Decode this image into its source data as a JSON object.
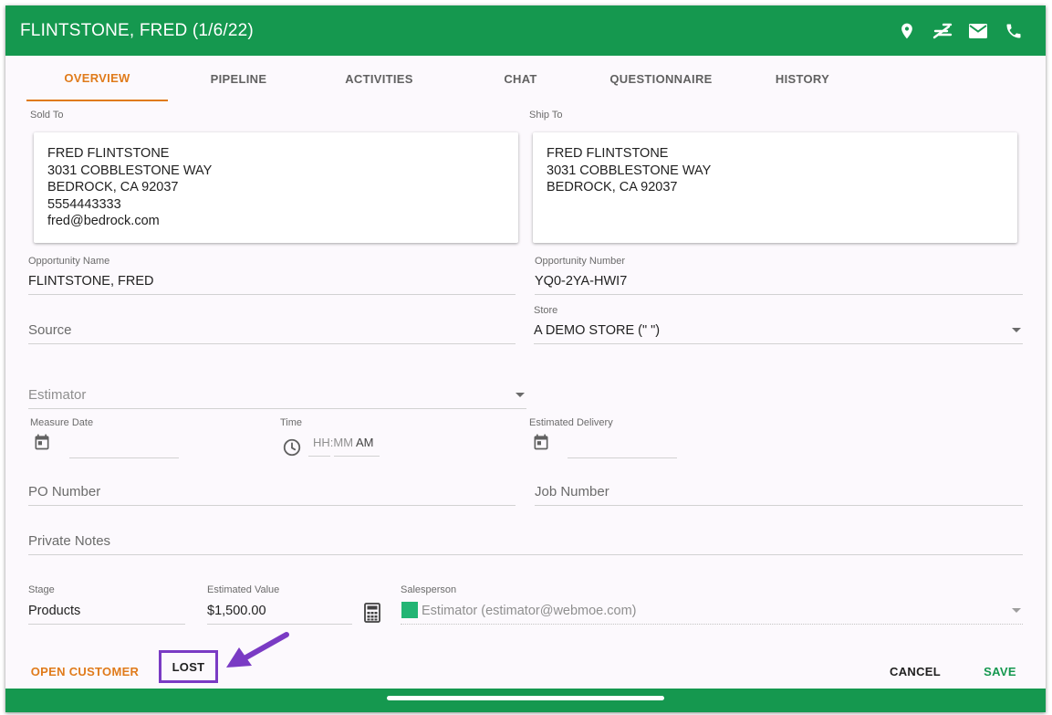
{
  "header": {
    "title": "FLINTSTONE, FRED (1/6/22)",
    "icons": [
      "location-pin-icon",
      "directions-icon",
      "mail-icon",
      "phone-icon"
    ]
  },
  "tabs": [
    {
      "label": "OVERVIEW",
      "active": true
    },
    {
      "label": "PIPELINE",
      "active": false
    },
    {
      "label": "ACTIVITIES",
      "active": false
    },
    {
      "label": "CHAT",
      "active": false
    },
    {
      "label": "QUESTIONNAIRE",
      "active": false
    },
    {
      "label": "HISTORY",
      "active": false
    }
  ],
  "sold_to": {
    "label": "Sold To",
    "lines": [
      "FRED FLINTSTONE",
      "3031 COBBLESTONE WAY",
      "BEDROCK, CA 92037",
      "5554443333",
      "fred@bedrock.com"
    ]
  },
  "ship_to": {
    "label": "Ship To",
    "lines": [
      "FRED FLINTSTONE",
      "3031 COBBLESTONE WAY",
      "BEDROCK, CA 92037"
    ]
  },
  "fields": {
    "opportunity_name": {
      "label": "Opportunity Name",
      "value": "FLINTSTONE, FRED"
    },
    "opportunity_number": {
      "label": "Opportunity Number",
      "value": "YQ0-2YA-HWI7"
    },
    "source": {
      "placeholder": "Source"
    },
    "store": {
      "label": "Store",
      "value": "A DEMO STORE (\" \")"
    },
    "estimator": {
      "placeholder": "Estimator"
    },
    "measure_date": {
      "label": "Measure Date",
      "value": ""
    },
    "time": {
      "label": "Time",
      "hhmm": "HH:MM",
      "ampm": "AM"
    },
    "estimated_delivery": {
      "label": "Estimated Delivery",
      "value": ""
    },
    "po_number": {
      "placeholder": "PO Number"
    },
    "job_number": {
      "placeholder": "Job Number"
    },
    "private_notes": {
      "placeholder": "Private Notes"
    },
    "stage": {
      "label": "Stage",
      "value": "Products"
    },
    "estimated_value": {
      "label": "Estimated Value",
      "value": "$1,500.00"
    },
    "salesperson": {
      "label": "Salesperson",
      "value": "Estimator (estimator@webmoe.com)",
      "swatch_color": "#22b574"
    }
  },
  "actions": {
    "open_customer": "OPEN CUSTOMER",
    "lost": "LOST",
    "cancel": "CANCEL",
    "save": "SAVE"
  },
  "colors": {
    "brand_green": "#15984f",
    "accent_orange": "#e07b1b",
    "annotation_purple": "#7a3bc4"
  }
}
